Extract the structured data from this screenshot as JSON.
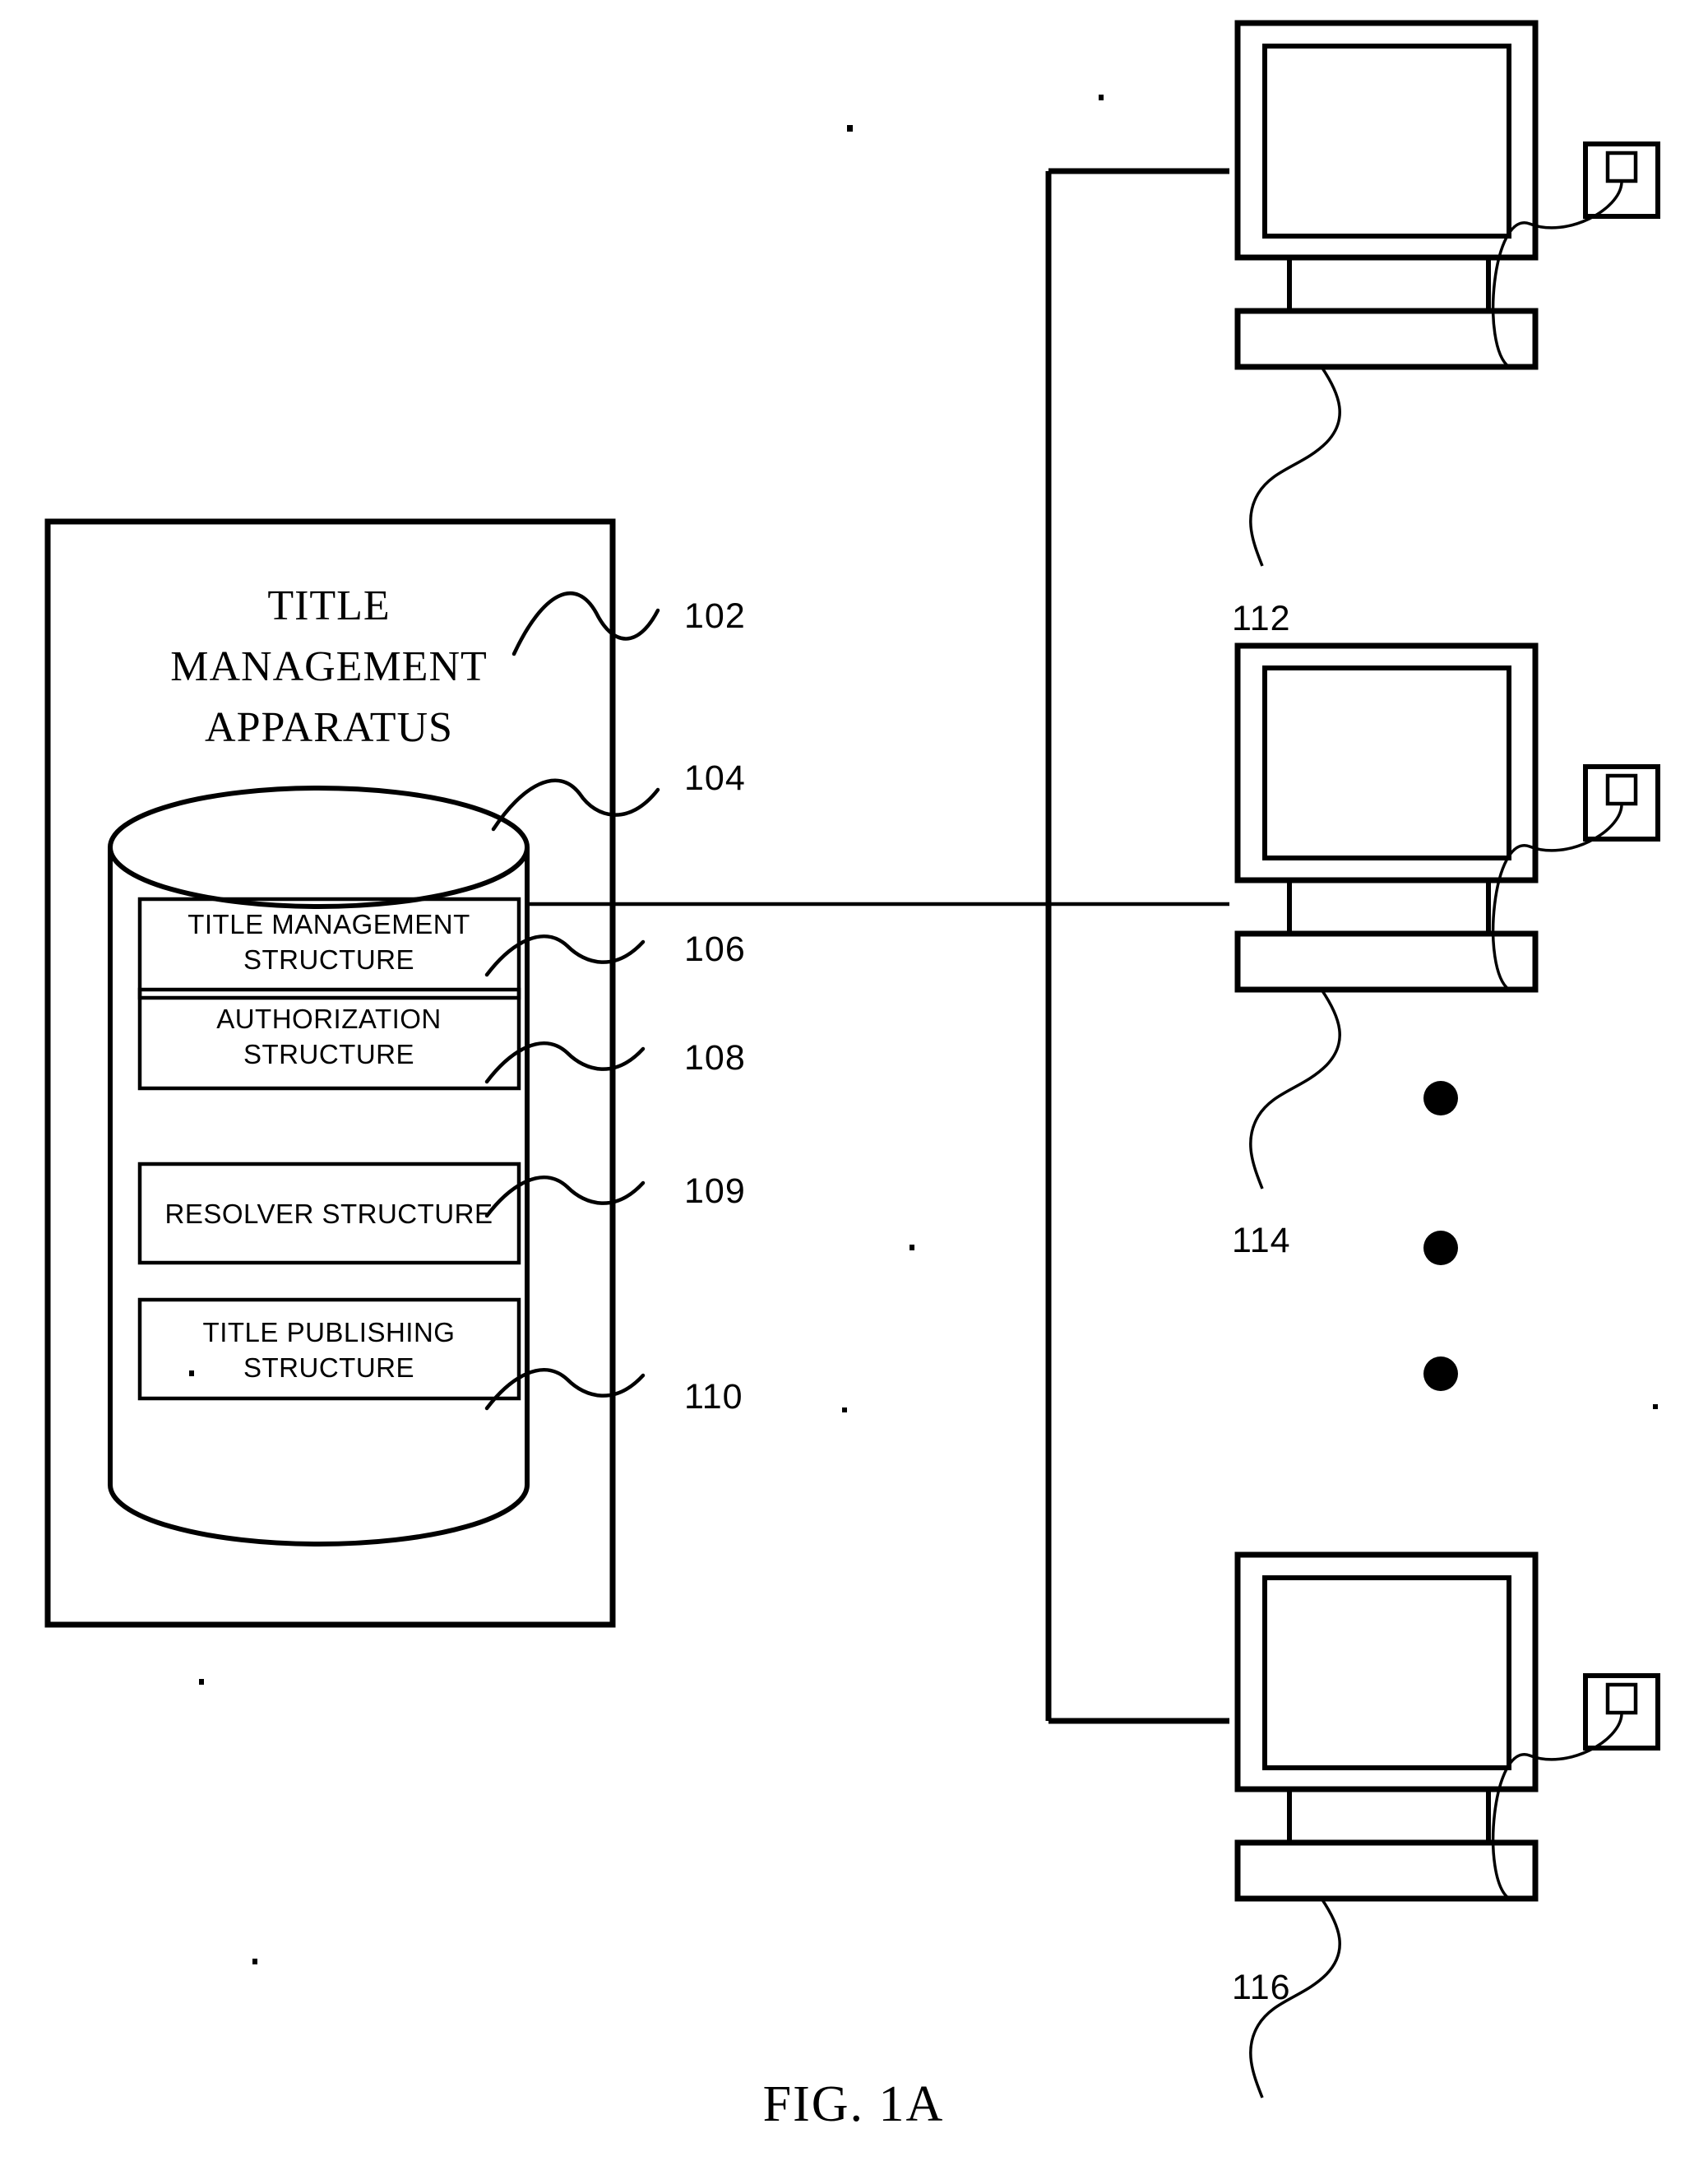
{
  "figure": {
    "caption": "FIG. 1A",
    "apparatus": {
      "title_lines": [
        "TITLE",
        "MANAGEMENT",
        "APPARATUS"
      ],
      "ref": "102",
      "database": {
        "ref": "104",
        "structures": [
          {
            "ref": "106",
            "lines": [
              "TITLE MANAGEMENT",
              "STRUCTURE"
            ]
          },
          {
            "ref": "108",
            "lines": [
              "AUTHORIZATION",
              "STRUCTURE"
            ]
          },
          {
            "ref": "109",
            "lines": [
              "RESOLVER STRUCTURE"
            ]
          },
          {
            "ref": "110",
            "lines": [
              "TITLE PUBLISHING",
              "STRUCTURE"
            ]
          }
        ]
      }
    },
    "terminals": [
      {
        "ref": "112",
        "name": "client-terminal-top"
      },
      {
        "ref": "114",
        "name": "client-terminal-middle"
      },
      {
        "ref": "116",
        "name": "client-terminal-bottom"
      }
    ],
    "ellipsis_dots": 3,
    "colors": {
      "ink": "#000000",
      "paper": "#ffffff"
    }
  }
}
